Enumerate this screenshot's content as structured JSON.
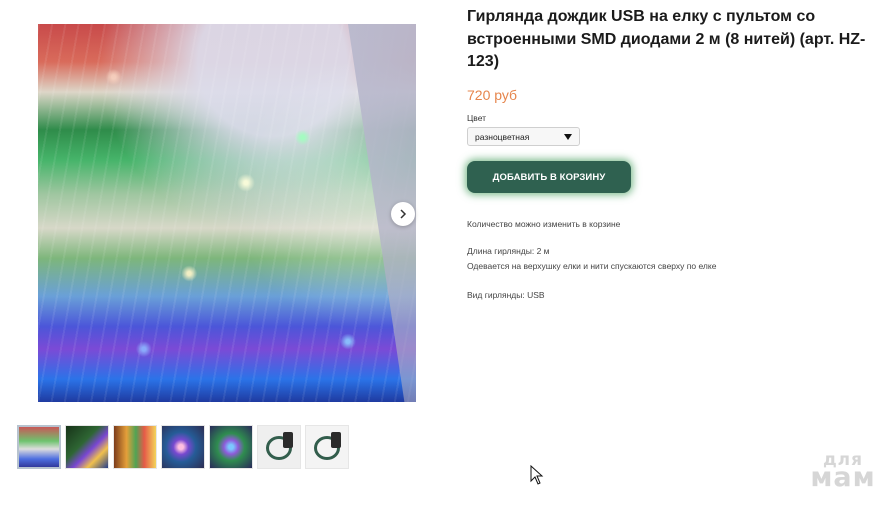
{
  "product": {
    "title": "Гирлянда дождик USB на елку с пультом со встроенными SMD диодами 2 м (8 нитей) (арт. HZ-123)",
    "price": "720 руб",
    "color_label": "Цвет",
    "color_value": "разноцветная",
    "cart_button": "ДОБАВИТЬ В КОРЗИНУ",
    "quantity_note": "Количество можно изменить в корзине",
    "length": "Длина гирлянды: 2 м",
    "mount": "Одевается на верхушку елки и нити спускаются сверху по елке",
    "type": "Вид гирлянды: USB"
  },
  "gallery": {
    "next_icon": "chevron-right-icon",
    "thumbnails": [
      "thumb-1",
      "thumb-2",
      "thumb-3",
      "thumb-4",
      "thumb-5",
      "thumb-6",
      "thumb-7"
    ],
    "active_index": 0
  },
  "watermark": {
    "top": "для",
    "bottom": "мам"
  },
  "colors": {
    "accent_price": "#e6854c",
    "button_bg": "#2f6150",
    "button_glow": "#49a05f"
  }
}
